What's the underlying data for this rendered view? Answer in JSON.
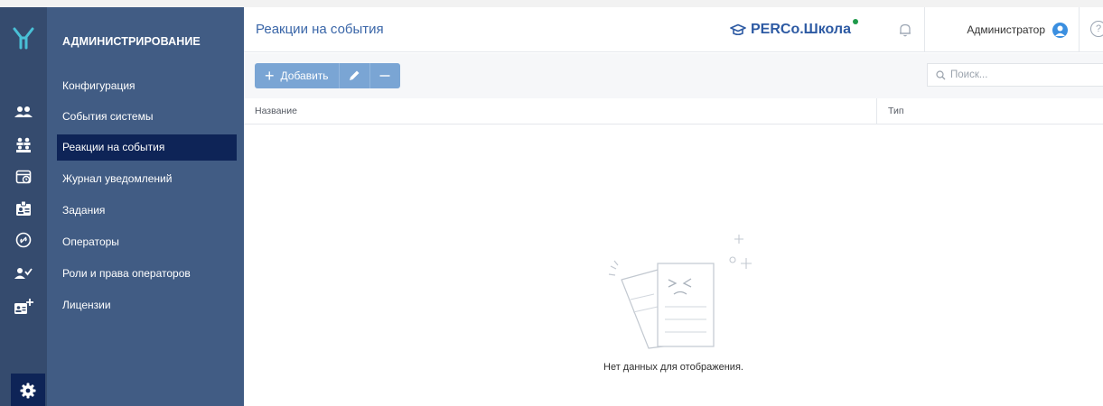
{
  "sidebar": {
    "title": "АДМИНИСТРИРОВАНИЕ",
    "items": [
      {
        "label": "Конфигурация",
        "active": false
      },
      {
        "label": "События системы",
        "active": false
      },
      {
        "label": "Реакции на события",
        "active": true
      },
      {
        "label": "Журнал уведомлений",
        "active": false
      },
      {
        "label": "Задания",
        "active": false
      },
      {
        "label": "Операторы",
        "active": false
      },
      {
        "label": "Роли и права операторов",
        "active": false
      },
      {
        "label": "Лицензии",
        "active": false
      }
    ]
  },
  "rail": {
    "icons": [
      "logo-icon",
      "users-icon",
      "groups-icon",
      "schedule-icon",
      "badge-icon",
      "access-icon",
      "verified-user-icon",
      "add-card-icon",
      "settings-icon"
    ],
    "active": "settings-icon"
  },
  "header": {
    "title": "Реакции на события",
    "brand": "PERCo.Школа",
    "user_name": "Администратор",
    "help": "?"
  },
  "toolbar": {
    "add_label": "Добавить",
    "search_placeholder": "Поиск..."
  },
  "table": {
    "columns": [
      "Название",
      "Тип"
    ],
    "rows": [],
    "empty_text": "Нет данных для отображения."
  },
  "colors": {
    "rail": "#354b6e",
    "menu": "#415c84",
    "active": "#0e2457",
    "accent": "#3a66a8",
    "button": "#7aa5d4",
    "status_dot": "#1f9a4a"
  }
}
